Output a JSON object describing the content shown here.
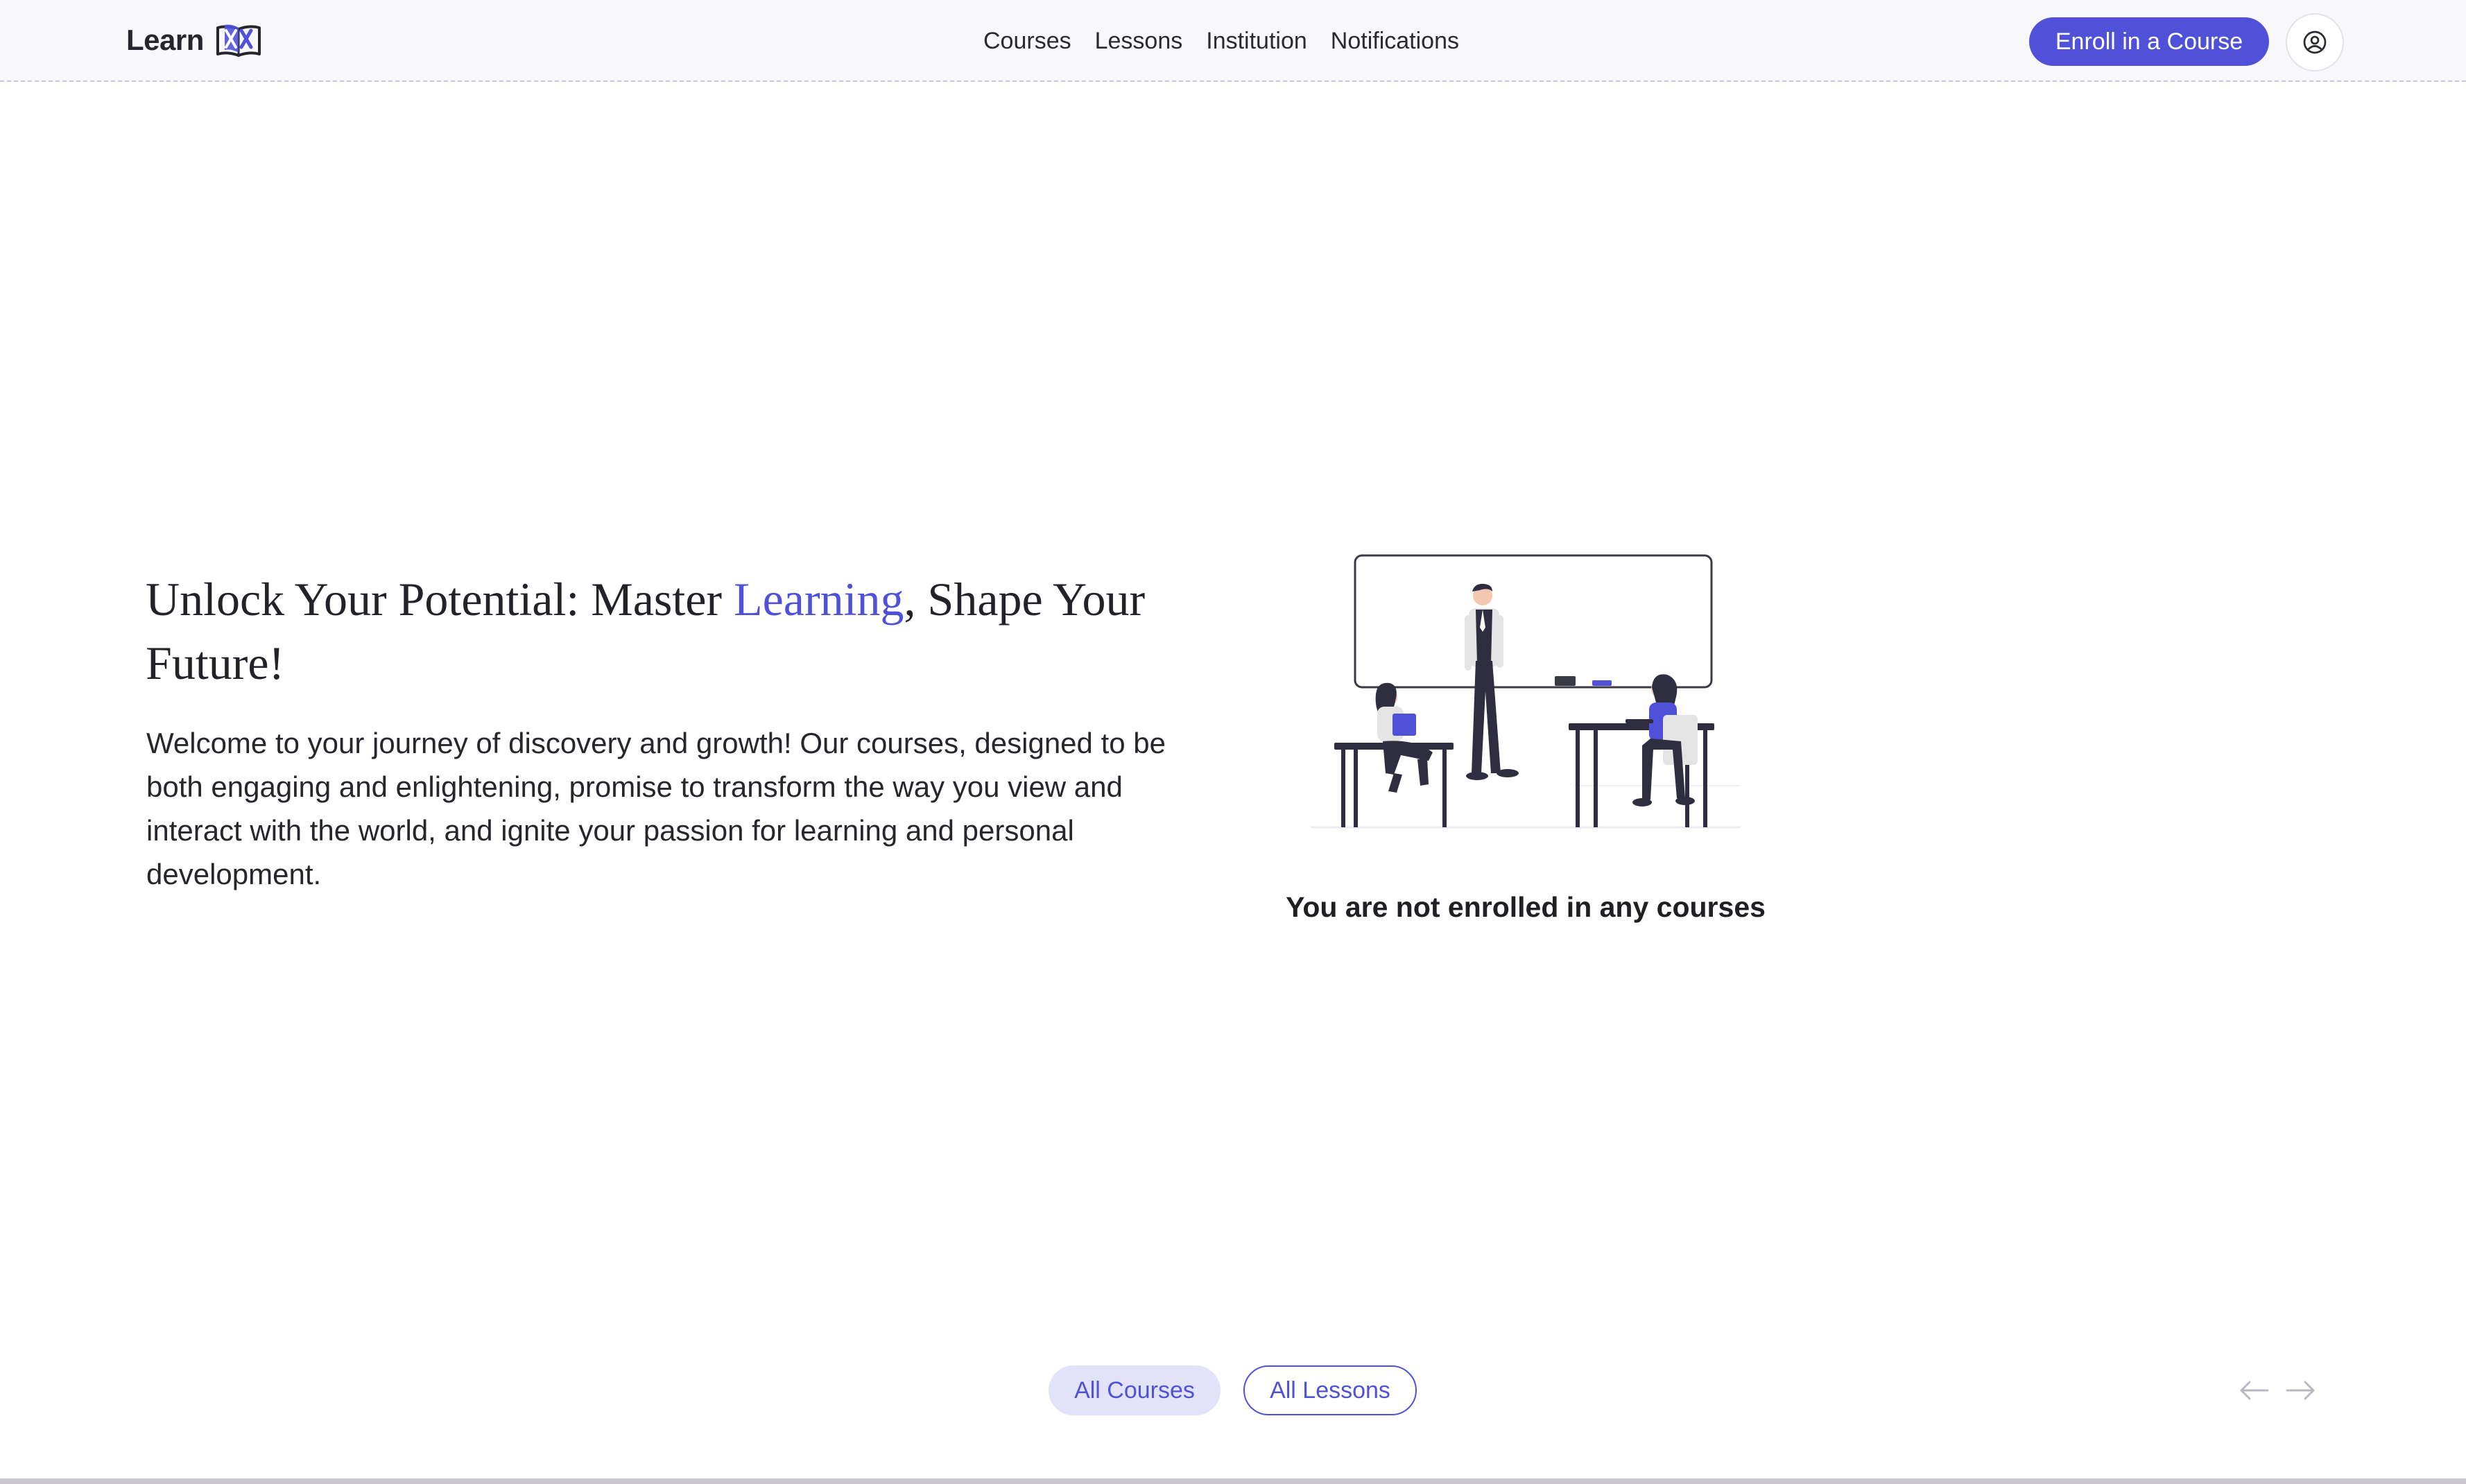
{
  "header": {
    "logo_text": "Learn",
    "logo_icon": "book-x-logo-icon",
    "nav": [
      {
        "label": "Courses"
      },
      {
        "label": "Lessons"
      },
      {
        "label": "Institution"
      },
      {
        "label": "Notifications"
      }
    ],
    "enroll_label": "Enroll in a Course",
    "profile_icon": "user-circle-icon"
  },
  "hero": {
    "title_part1": "Unlock Your Potential: Master ",
    "title_accent": "Learning",
    "title_part2": ", Shape Your Future!",
    "body": "Welcome to your journey of discovery and growth! Our courses, designed to be both engaging and enlightening, promise to transform the way you view and interact with the world, and ignite your passion for learning and personal development."
  },
  "empty_state": {
    "illustration": "classroom-illustration",
    "label": "You are not enrolled in any courses"
  },
  "filters": [
    {
      "label": "All Courses",
      "active": true
    },
    {
      "label": "All Lessons",
      "active": false
    }
  ],
  "pagination": {
    "prev_icon": "arrow-left-icon",
    "next_icon": "arrow-right-icon"
  },
  "colors": {
    "accent": "#4f52d8",
    "accent_soft": "#e2e3f8",
    "header_bg": "#f8f8fa",
    "text": "#1f1f24"
  }
}
